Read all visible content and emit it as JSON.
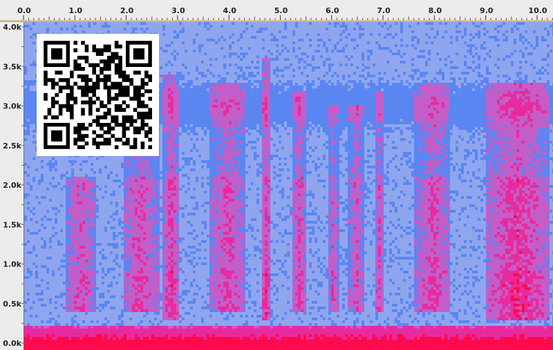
{
  "chart_data": {
    "type": "heatmap",
    "title": "",
    "xlabel": "",
    "ylabel": "",
    "x_ticks": [
      "0.0",
      "1.0",
      "2.0",
      "3.0",
      "4.0",
      "5.0",
      "6.0",
      "7.0",
      "8.0",
      "9.0",
      "10.0"
    ],
    "y_ticks": [
      "4.0k",
      "3.5k",
      "3.0k",
      "2.5k",
      "2.0k",
      "1.5k",
      "1.0k",
      "0.5k",
      "0.0k"
    ],
    "x_range": [
      0,
      10.3
    ],
    "y_range": [
      0,
      4000
    ],
    "x_unit": "seconds",
    "y_unit": "Hz",
    "colormap": [
      "#8fa6ee",
      "#5a86f2",
      "#c35ec8",
      "#e72b9e",
      "#ff0a4c"
    ],
    "energy_columns": [
      {
        "t": 0.8,
        "t_end": 1.4,
        "f_low": 400,
        "f_high": 2100,
        "level": 0.55
      },
      {
        "t": 1.9,
        "t_end": 2.6,
        "f_low": 400,
        "f_high": 3000,
        "level": 0.6
      },
      {
        "t": 2.7,
        "t_end": 3.0,
        "f_low": 300,
        "f_high": 3400,
        "level": 0.7
      },
      {
        "t": 3.6,
        "t_end": 4.3,
        "f_low": 400,
        "f_high": 3300,
        "level": 0.6
      },
      {
        "t": 4.6,
        "t_end": 4.8,
        "f_low": 300,
        "f_high": 3600,
        "level": 0.7
      },
      {
        "t": 5.2,
        "t_end": 5.5,
        "f_low": 400,
        "f_high": 3200,
        "level": 0.6
      },
      {
        "t": 5.9,
        "t_end": 6.1,
        "f_low": 400,
        "f_high": 3000,
        "level": 0.55
      },
      {
        "t": 6.3,
        "t_end": 6.6,
        "f_low": 400,
        "f_high": 3000,
        "level": 0.55
      },
      {
        "t": 6.8,
        "t_end": 7.0,
        "f_low": 400,
        "f_high": 3200,
        "level": 0.55
      },
      {
        "t": 7.6,
        "t_end": 8.3,
        "f_low": 400,
        "f_high": 3300,
        "level": 0.6
      },
      {
        "t": 9.0,
        "t_end": 10.2,
        "f_low": 300,
        "f_high": 3300,
        "level": 0.75
      }
    ]
  },
  "overlay": {
    "qr_icon": "qr-code-icon"
  }
}
